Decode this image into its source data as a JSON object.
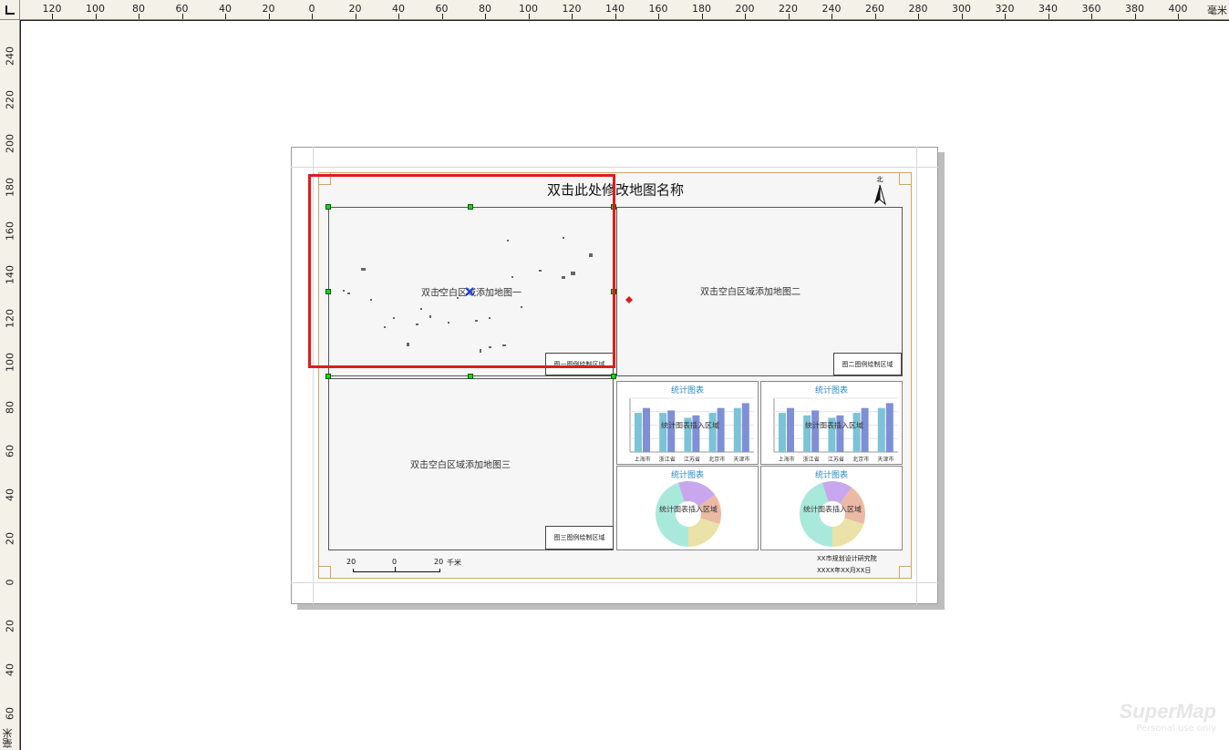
{
  "ruler": {
    "h_labels": [
      "120",
      "100",
      "80",
      "60",
      "40",
      "20",
      "0",
      "20",
      "40",
      "60",
      "80",
      "100",
      "120",
      "140",
      "160",
      "180",
      "200",
      "220",
      "240",
      "260",
      "280",
      "300",
      "320",
      "340",
      "360",
      "380",
      "400"
    ],
    "v_labels": [
      "240",
      "220",
      "200",
      "180",
      "160",
      "140",
      "120",
      "100",
      "80",
      "60",
      "40",
      "20",
      "0",
      "20",
      "40",
      "60"
    ],
    "unit": "毫米"
  },
  "layout": {
    "map_title": "双击此处修改地图名称",
    "north_label": "北",
    "map1_text": "双击空白区域添加地图一",
    "map2_text": "双击空白区域添加地图二",
    "map3_text": "双击空白区域添加地图三",
    "legend1": "图一图例绘制区域",
    "legend2": "图二图例绘制区域",
    "legend3": "图三图例绘制区域",
    "chart_title_1": "统计图表",
    "chart_title_2": "统计图表",
    "chart_title_3": "统计图表",
    "chart_title_4": "统计图表",
    "chart_placeholder": "统计图表插入区域",
    "scale_left": "20",
    "scale_mid": "0",
    "scale_right": "20",
    "scale_unit": "千米",
    "org_text": "XX市规划设计研究院",
    "date_text": "XXXX年XX月XX日"
  },
  "chart_data": [
    {
      "type": "bar",
      "title": "统计图表",
      "categories": [
        "上海市",
        "浙江省",
        "江苏省",
        "北京市",
        "天津市"
      ],
      "series": [
        {
          "values": [
            8,
            8,
            7,
            8,
            9
          ]
        },
        {
          "values": [
            9,
            8.5,
            7.5,
            9,
            10
          ]
        }
      ],
      "ylim": [
        0,
        11
      ],
      "colors": [
        "#7bc3d6",
        "#7f8fd6"
      ]
    },
    {
      "type": "bar",
      "title": "统计图表",
      "categories": [
        "上海市",
        "浙江省",
        "江苏省",
        "北京市",
        "天津市"
      ],
      "series": [
        {
          "values": [
            8,
            7.5,
            7,
            8,
            9
          ]
        },
        {
          "values": [
            9,
            8.5,
            7.5,
            9,
            10
          ]
        }
      ],
      "ylim": [
        0,
        11
      ],
      "colors": [
        "#7bc3d6",
        "#7f8fd6"
      ]
    },
    {
      "type": "pie",
      "title": "统计图表",
      "values": [
        45,
        20,
        15,
        20
      ],
      "colors": [
        "#a9e9dc",
        "#c9a7ee",
        "#ebb9a4",
        "#eae2a6"
      ]
    },
    {
      "type": "pie",
      "title": "统计图表",
      "values": [
        45,
        15,
        20,
        20
      ],
      "colors": [
        "#a9e9dc",
        "#c9a7ee",
        "#ebb9a4",
        "#eae2a6"
      ]
    }
  ],
  "watermark": {
    "brand": "SuperMap",
    "sub": "Personal use only"
  },
  "colors": {
    "selection": "#e01b1b",
    "handle": "#19d219",
    "frame_gold": "#c9a86a",
    "chart_title": "#2a8ac8"
  }
}
